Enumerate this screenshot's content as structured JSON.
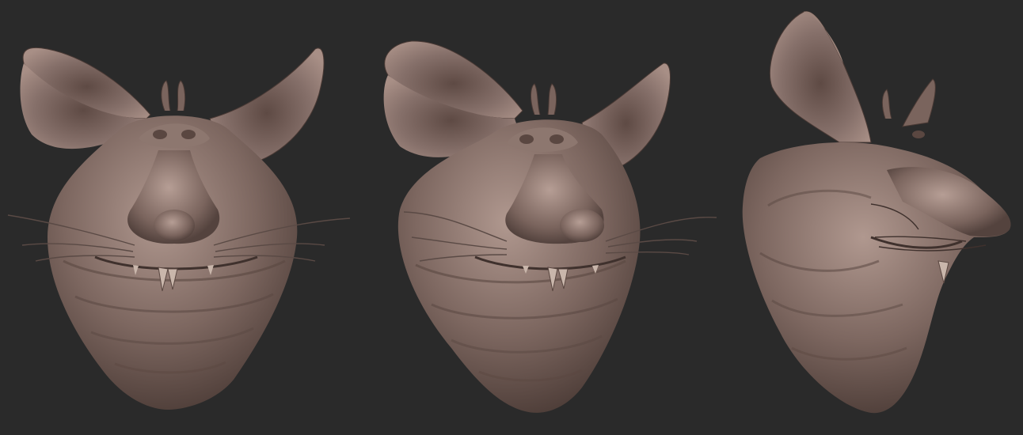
{
  "scene": {
    "background_color": "#2a2a2a",
    "skin_color": "#7d6760",
    "skin_highlight": "#b0988f",
    "skin_shadow": "#4a3a35",
    "whisker_color": "#5a4a45",
    "tooth_color": "#c9b6ab",
    "views": [
      {
        "name": "front-view"
      },
      {
        "name": "three-quarter-view"
      },
      {
        "name": "side-view"
      }
    ]
  }
}
